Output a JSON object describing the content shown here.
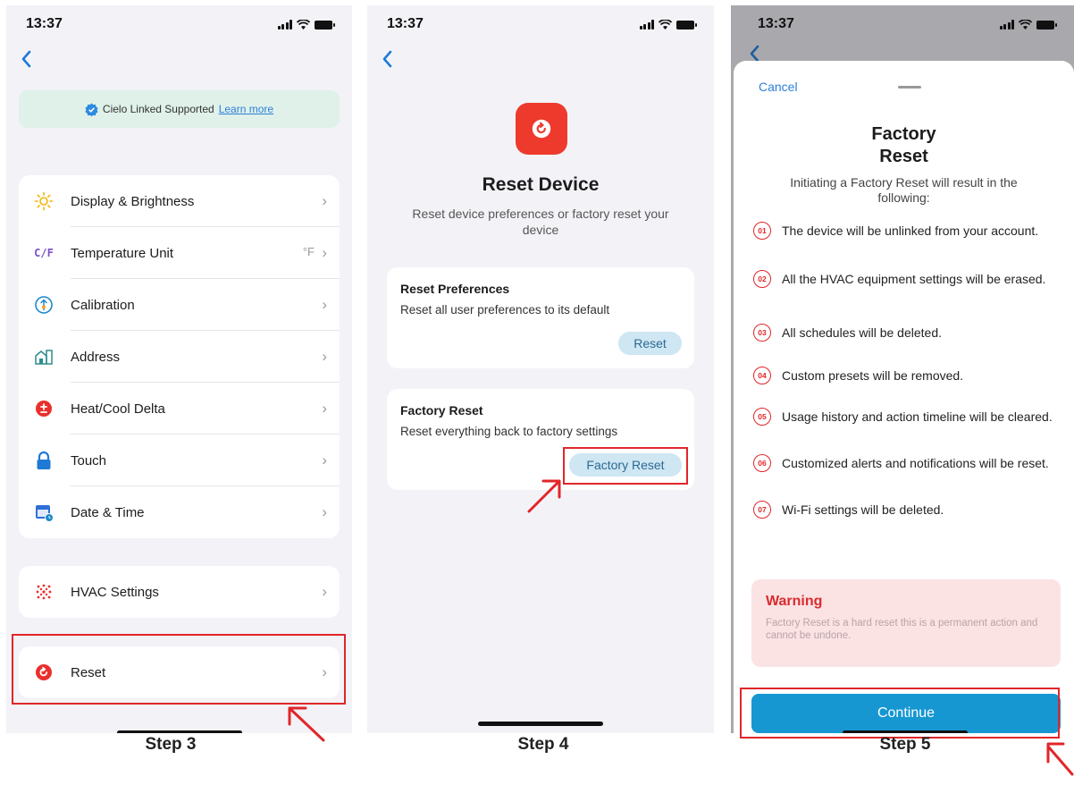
{
  "status_time": "13:37",
  "step3": {
    "banner_text": "Cielo Linked Supported",
    "banner_link": "Learn more",
    "settings": [
      {
        "label": "Display & Brightness",
        "icon": "sun-icon"
      },
      {
        "label": "Temperature Unit",
        "icon": "cf-icon",
        "icon_text": "C/F",
        "value": "°F"
      },
      {
        "label": "Calibration",
        "icon": "calibration-icon"
      },
      {
        "label": "Address",
        "icon": "address-icon"
      },
      {
        "label": "Heat/Cool Delta",
        "icon": "delta-icon"
      },
      {
        "label": "Touch",
        "icon": "lock-icon"
      },
      {
        "label": "Date & Time",
        "icon": "calendar-icon"
      }
    ],
    "hvac_label": "HVAC Settings",
    "reset_label": "Reset",
    "step_label": "Step 3"
  },
  "step4": {
    "title": "Reset Device",
    "subtitle": "Reset device preferences or factory reset your device",
    "prefs": {
      "title": "Reset Preferences",
      "desc": "Reset all user preferences to its default",
      "button": "Reset"
    },
    "factory": {
      "title": "Factory Reset",
      "desc": "Reset everything back to factory settings",
      "button": "Factory Reset"
    },
    "step_label": "Step 4"
  },
  "step5": {
    "cancel": "Cancel",
    "title_line1": "Factory",
    "title_line2": "Reset",
    "subtitle": "Initiating a Factory Reset will result in the following:",
    "items": [
      {
        "num": "01",
        "text": "The device will be unlinked from your account."
      },
      {
        "num": "02",
        "text": "All the HVAC equipment settings will be erased."
      },
      {
        "num": "03",
        "text": "All schedules will be deleted."
      },
      {
        "num": "04",
        "text": "Custom presets will be removed."
      },
      {
        "num": "05",
        "text": "Usage history and action timeline will be cleared."
      },
      {
        "num": "06",
        "text": "Customized alerts and notifications will be reset."
      },
      {
        "num": "07",
        "text": "Wi-Fi settings will be deleted."
      }
    ],
    "warning_title": "Warning",
    "warning_text": "Factory Reset is a hard reset this is a permanent action and cannot be undone.",
    "continue": "Continue",
    "step_label": "Step 5"
  },
  "colors": {
    "accent_red": "#e0262a",
    "link_blue": "#2f7fd8",
    "continue_blue": "#1697d2",
    "banner_green": "#dff1e9"
  }
}
